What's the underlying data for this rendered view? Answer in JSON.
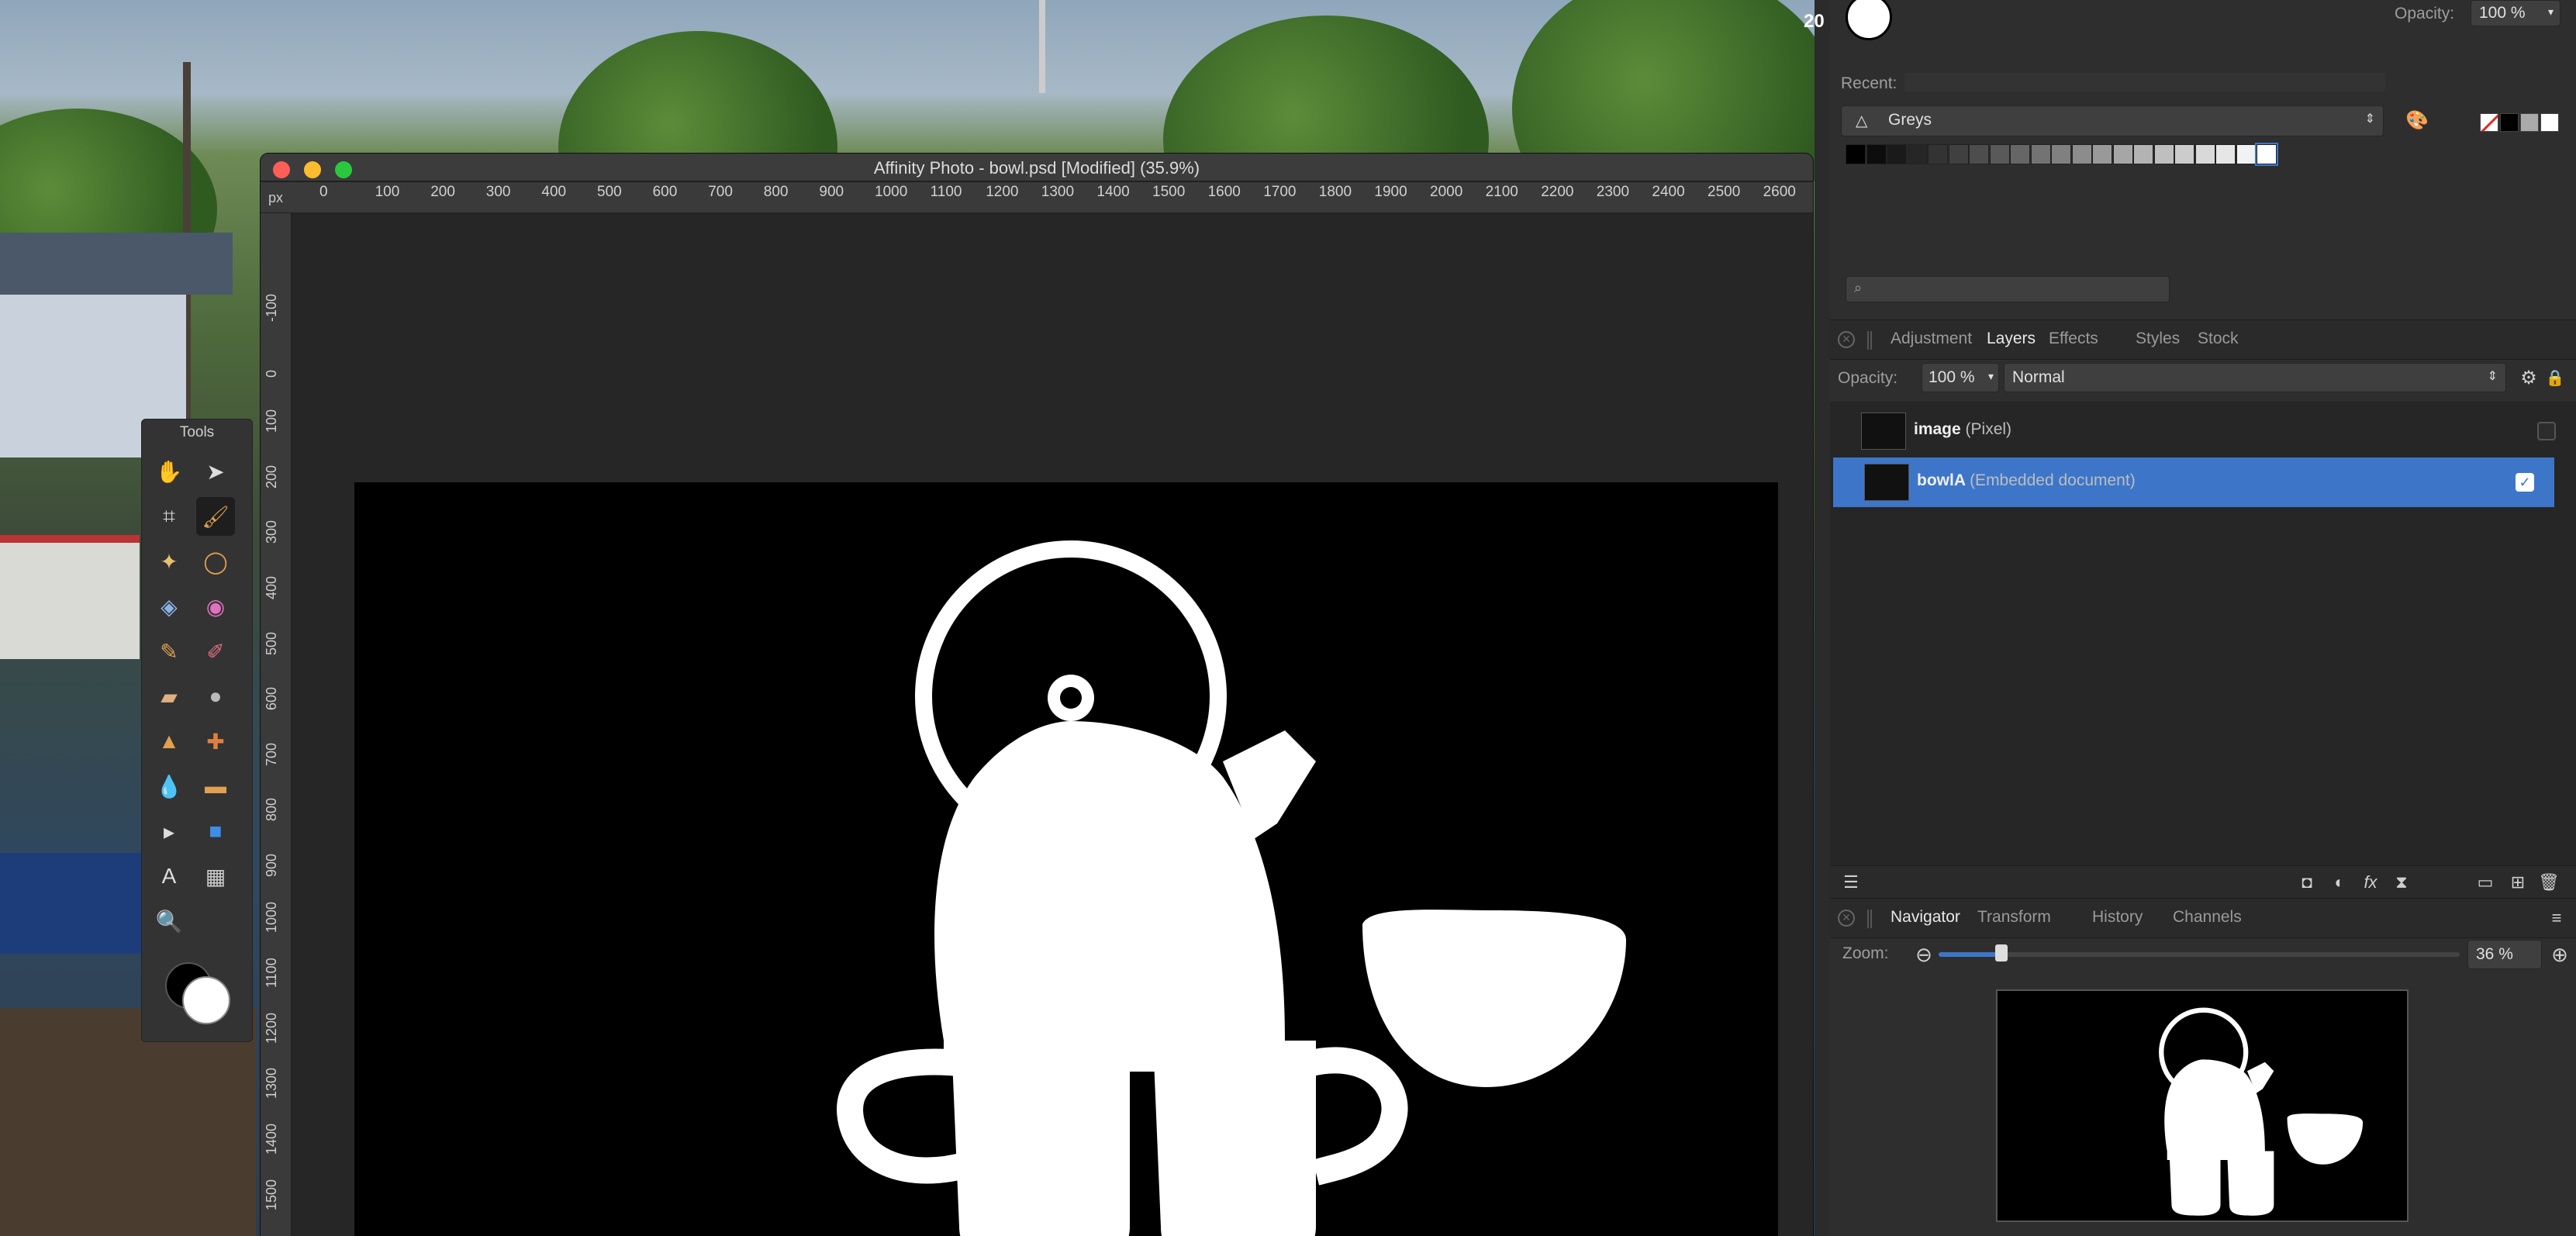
{
  "document": {
    "title": "Affinity Photo - bowl.psd [Modified] (35.9%)",
    "ruler_unit": "px",
    "h_ruler": [
      "0",
      "100",
      "200",
      "300",
      "400",
      "500",
      "600",
      "700",
      "800",
      "900",
      "1000",
      "1100",
      "1200",
      "1300",
      "1400",
      "1500",
      "1600",
      "1700",
      "1800",
      "1900",
      "2000",
      "2100",
      "2200",
      "2300",
      "2400",
      "2500",
      "2600"
    ],
    "v_ruler": [
      "-100",
      "0",
      "100",
      "200",
      "300",
      "400",
      "500",
      "600",
      "700",
      "800",
      "900",
      "1000",
      "1100",
      "1200",
      "1300",
      "1400",
      "1500"
    ]
  },
  "tools_panel": {
    "title": "Tools",
    "tools": [
      {
        "name": "hand-tool-icon",
        "glyph": "✋"
      },
      {
        "name": "move-tool-icon",
        "glyph": "➤"
      },
      {
        "name": "crop-tool-icon",
        "glyph": "⌗"
      },
      {
        "name": "selection-brush-icon",
        "glyph": "🖌"
      },
      {
        "name": "flood-select-icon",
        "glyph": "✦"
      },
      {
        "name": "freehand-select-icon",
        "glyph": "◯"
      },
      {
        "name": "fill-tool-icon",
        "glyph": "◈"
      },
      {
        "name": "color-picker-icon",
        "glyph": "◉"
      },
      {
        "name": "paint-brush-icon",
        "glyph": "✎"
      },
      {
        "name": "color-replacement-icon",
        "glyph": "✐"
      },
      {
        "name": "erase-brush-icon",
        "glyph": "▰"
      },
      {
        "name": "burn-brush-icon",
        "glyph": "●"
      },
      {
        "name": "clone-brush-icon",
        "glyph": "▲"
      },
      {
        "name": "healing-brush-icon",
        "glyph": "✚"
      },
      {
        "name": "blur-brush-icon",
        "glyph": "💧"
      },
      {
        "name": "inpainting-brush-icon",
        "glyph": "▬"
      },
      {
        "name": "node-tool-icon",
        "glyph": "▸"
      },
      {
        "name": "rectangle-tool-icon",
        "glyph": "■"
      },
      {
        "name": "text-tool-icon",
        "glyph": "A"
      },
      {
        "name": "mesh-warp-icon",
        "glyph": "▦"
      },
      {
        "name": "zoom-tool-icon",
        "glyph": "🔍"
      }
    ]
  },
  "studio": {
    "top_num": "20",
    "opacity_label": "Opacity:",
    "opacity_value": "100 %",
    "recent_label": "Recent:",
    "palette_name": "Greys",
    "swatches": [
      "#000000",
      "#0d0d0d",
      "#1a1a1a",
      "#262626",
      "#333333",
      "#404040",
      "#4d4d4d",
      "#595959",
      "#666666",
      "#737373",
      "#808080",
      "#8c8c8c",
      "#999999",
      "#a6a6a6",
      "#b3b3b3",
      "#bfbfbf",
      "#cccccc",
      "#d9d9d9",
      "#e6e6e6",
      "#f2f2f2",
      "#ffffff"
    ],
    "panel_tabs": [
      "Adjustment",
      "Layers",
      "Effects",
      "Styles",
      "Stock"
    ],
    "active_panel_tab": "Layers",
    "layers_opacity_label": "Opacity:",
    "layers_opacity_value": "100 %",
    "blend_mode": "Normal",
    "layers": [
      {
        "name": "image",
        "kind": "(Pixel)",
        "selected": false
      },
      {
        "name": "bowlA",
        "kind": "(Embedded document)",
        "selected": true
      }
    ],
    "nav_tabs": [
      "Navigator",
      "Transform",
      "History",
      "Channels"
    ],
    "active_nav_tab": "Navigator",
    "zoom_label": "Zoom:",
    "zoom_value": "36 %",
    "zoom_fraction": 0.12
  },
  "colors": {
    "selection_blue": "#3d76c9",
    "close_red": "#fd5e57",
    "minimize_yellow": "#fdbb2f",
    "maximize_green": "#2bc73f",
    "artboard": "#000000",
    "shape": "#ffffff"
  }
}
